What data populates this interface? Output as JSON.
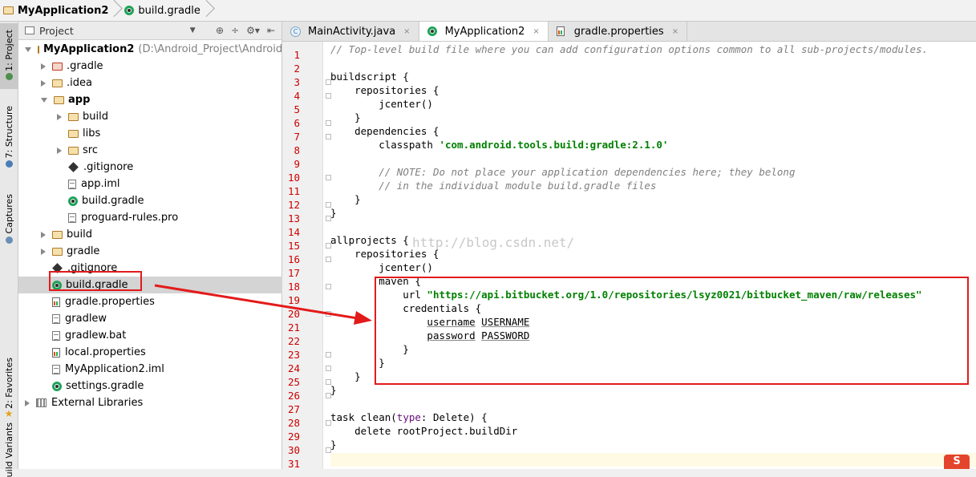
{
  "breadcrumb": {
    "project": "MyApplication2",
    "file": "build.gradle"
  },
  "sidebar_tabs": [
    {
      "label": "1: Project"
    },
    {
      "label": "7: Structure"
    },
    {
      "label": "Captures"
    },
    {
      "label": "2: Favorites"
    },
    {
      "label": "uild Variants"
    }
  ],
  "project_panel": {
    "title": "Project",
    "tree": [
      {
        "label": "MyApplication2",
        "path": "(D:\\Android_Project\\Android_Stu",
        "bold": true,
        "indent": 0,
        "arrow": "d",
        "icon": "folder-mod"
      },
      {
        "label": ".gradle",
        "indent": 1,
        "arrow": "r",
        "icon": "folder-red"
      },
      {
        "label": ".idea",
        "indent": 1,
        "arrow": "r",
        "icon": "folder"
      },
      {
        "label": "app",
        "bold": true,
        "indent": 1,
        "arrow": "d",
        "icon": "folder-mod"
      },
      {
        "label": "build",
        "indent": 2,
        "arrow": "r",
        "icon": "folder"
      },
      {
        "label": "libs",
        "indent": 2,
        "arrow": "none",
        "icon": "folder"
      },
      {
        "label": "src",
        "indent": 2,
        "arrow": "r",
        "icon": "folder"
      },
      {
        "label": ".gitignore",
        "indent": 2,
        "arrow": "none",
        "icon": "git"
      },
      {
        "label": "app.iml",
        "indent": 2,
        "arrow": "none",
        "icon": "file"
      },
      {
        "label": "build.gradle",
        "indent": 2,
        "arrow": "none",
        "icon": "gradle"
      },
      {
        "label": "proguard-rules.pro",
        "indent": 2,
        "arrow": "none",
        "icon": "file"
      },
      {
        "label": "build",
        "indent": 1,
        "arrow": "r",
        "icon": "folder"
      },
      {
        "label": "gradle",
        "indent": 1,
        "arrow": "r",
        "icon": "folder"
      },
      {
        "label": ".gitignore",
        "indent": 1,
        "arrow": "none",
        "icon": "git"
      },
      {
        "label": "build.gradle",
        "indent": 1,
        "arrow": "none",
        "icon": "gradle",
        "selected": true
      },
      {
        "label": "gradle.properties",
        "indent": 1,
        "arrow": "none",
        "icon": "chart"
      },
      {
        "label": "gradlew",
        "indent": 1,
        "arrow": "none",
        "icon": "file"
      },
      {
        "label": "gradlew.bat",
        "indent": 1,
        "arrow": "none",
        "icon": "file"
      },
      {
        "label": "local.properties",
        "indent": 1,
        "arrow": "none",
        "icon": "chart"
      },
      {
        "label": "MyApplication2.iml",
        "indent": 1,
        "arrow": "none",
        "icon": "file"
      },
      {
        "label": "settings.gradle",
        "indent": 1,
        "arrow": "none",
        "icon": "gradle"
      },
      {
        "label": "External Libraries",
        "indent": 0,
        "arrow": "r",
        "icon": "lib"
      }
    ]
  },
  "editor": {
    "tabs": [
      {
        "label": "MainActivity.java",
        "icon": "c",
        "active": false
      },
      {
        "label": "MyApplication2",
        "icon": "gradle",
        "active": true
      },
      {
        "label": "gradle.properties",
        "icon": "chart",
        "active": false
      }
    ],
    "lines": [
      [
        [
          "cm",
          "// Top-level build file where you can add configuration options common to all sub-projects/modules."
        ]
      ],
      [],
      [
        [
          "",
          "buildscript {"
        ]
      ],
      [
        [
          "",
          "    repositories {"
        ]
      ],
      [
        [
          "",
          "        jcenter()"
        ]
      ],
      [
        [
          "",
          "    }"
        ]
      ],
      [
        [
          "",
          "    dependencies {"
        ]
      ],
      [
        [
          "",
          "        classpath "
        ],
        [
          "str",
          "'com.android.tools.build:gradle:2.1.0'"
        ]
      ],
      [],
      [
        [
          "",
          "        "
        ],
        [
          "cm",
          "// NOTE: Do not place your application dependencies here; they belong"
        ]
      ],
      [
        [
          "",
          "        "
        ],
        [
          "cm",
          "// in the individual module build.gradle files"
        ]
      ],
      [
        [
          "",
          "    }"
        ]
      ],
      [
        [
          "",
          "}"
        ]
      ],
      [],
      [
        [
          "",
          "allprojects {"
        ]
      ],
      [
        [
          "",
          "    repositories {"
        ]
      ],
      [
        [
          "",
          "        jcenter()"
        ]
      ],
      [
        [
          "",
          "        maven {"
        ]
      ],
      [
        [
          "",
          "            url "
        ],
        [
          "str",
          "\"https://api.bitbucket.org/1.0/repositories/lsyz0021/bitbucket_maven/raw/releases\""
        ]
      ],
      [
        [
          "",
          "            credentials {"
        ]
      ],
      [
        [
          "",
          "                "
        ],
        [
          "ul",
          "username"
        ],
        [
          "",
          " "
        ],
        [
          "ul",
          "USERNAME"
        ]
      ],
      [
        [
          "",
          "                "
        ],
        [
          "ul",
          "password"
        ],
        [
          "",
          " "
        ],
        [
          "ul",
          "PASSWORD"
        ]
      ],
      [
        [
          "",
          "            }"
        ]
      ],
      [
        [
          "",
          "        }"
        ]
      ],
      [
        [
          "",
          "    }"
        ]
      ],
      [
        [
          "",
          "}"
        ]
      ],
      [],
      [
        [
          "",
          "task clean("
        ],
        [
          "kw",
          "type"
        ],
        [
          "",
          ": Delete) {"
        ]
      ],
      [
        [
          "",
          "    delete rootProject.buildDir"
        ]
      ],
      [
        [
          "",
          "}"
        ]
      ],
      []
    ]
  },
  "watermark": "http://blog.csdn.net/",
  "logo_text": "S"
}
